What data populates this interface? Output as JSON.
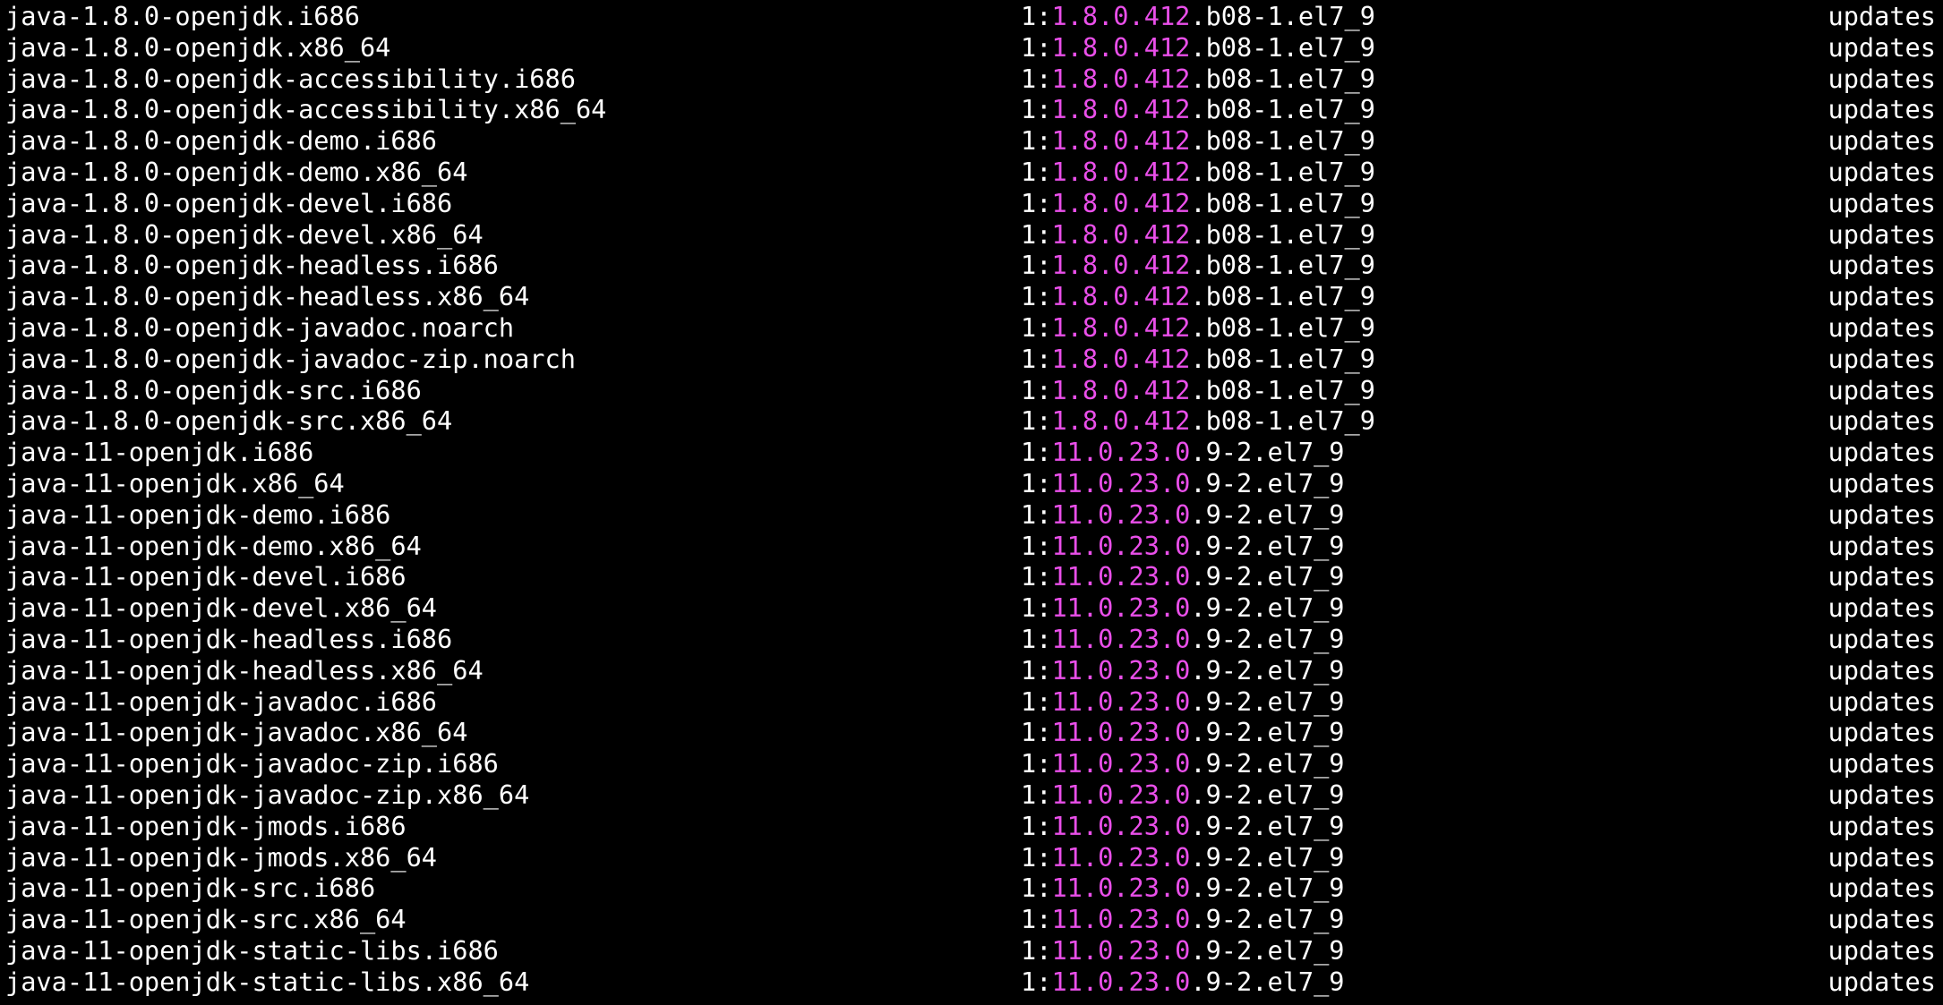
{
  "colors": {
    "background": "#000000",
    "text": "#ffffff",
    "highlight": "#ea4fea"
  },
  "rows": [
    {
      "name": "java-1.8.0-openjdk.i686",
      "epoch": "1:",
      "ver_hl": "1.8.0.412",
      "ver_rest": ".b08-1.el7_9",
      "repo": "updates"
    },
    {
      "name": "java-1.8.0-openjdk.x86_64",
      "epoch": "1:",
      "ver_hl": "1.8.0.412",
      "ver_rest": ".b08-1.el7_9",
      "repo": "updates"
    },
    {
      "name": "java-1.8.0-openjdk-accessibility.i686",
      "epoch": "1:",
      "ver_hl": "1.8.0.412",
      "ver_rest": ".b08-1.el7_9",
      "repo": "updates"
    },
    {
      "name": "java-1.8.0-openjdk-accessibility.x86_64",
      "epoch": "1:",
      "ver_hl": "1.8.0.412",
      "ver_rest": ".b08-1.el7_9",
      "repo": "updates"
    },
    {
      "name": "java-1.8.0-openjdk-demo.i686",
      "epoch": "1:",
      "ver_hl": "1.8.0.412",
      "ver_rest": ".b08-1.el7_9",
      "repo": "updates"
    },
    {
      "name": "java-1.8.0-openjdk-demo.x86_64",
      "epoch": "1:",
      "ver_hl": "1.8.0.412",
      "ver_rest": ".b08-1.el7_9",
      "repo": "updates"
    },
    {
      "name": "java-1.8.0-openjdk-devel.i686",
      "epoch": "1:",
      "ver_hl": "1.8.0.412",
      "ver_rest": ".b08-1.el7_9",
      "repo": "updates"
    },
    {
      "name": "java-1.8.0-openjdk-devel.x86_64",
      "epoch": "1:",
      "ver_hl": "1.8.0.412",
      "ver_rest": ".b08-1.el7_9",
      "repo": "updates"
    },
    {
      "name": "java-1.8.0-openjdk-headless.i686",
      "epoch": "1:",
      "ver_hl": "1.8.0.412",
      "ver_rest": ".b08-1.el7_9",
      "repo": "updates"
    },
    {
      "name": "java-1.8.0-openjdk-headless.x86_64",
      "epoch": "1:",
      "ver_hl": "1.8.0.412",
      "ver_rest": ".b08-1.el7_9",
      "repo": "updates"
    },
    {
      "name": "java-1.8.0-openjdk-javadoc.noarch",
      "epoch": "1:",
      "ver_hl": "1.8.0.412",
      "ver_rest": ".b08-1.el7_9",
      "repo": "updates"
    },
    {
      "name": "java-1.8.0-openjdk-javadoc-zip.noarch",
      "epoch": "1:",
      "ver_hl": "1.8.0.412",
      "ver_rest": ".b08-1.el7_9",
      "repo": "updates"
    },
    {
      "name": "java-1.8.0-openjdk-src.i686",
      "epoch": "1:",
      "ver_hl": "1.8.0.412",
      "ver_rest": ".b08-1.el7_9",
      "repo": "updates"
    },
    {
      "name": "java-1.8.0-openjdk-src.x86_64",
      "epoch": "1:",
      "ver_hl": "1.8.0.412",
      "ver_rest": ".b08-1.el7_9",
      "repo": "updates"
    },
    {
      "name": "java-11-openjdk.i686",
      "epoch": "1:",
      "ver_hl": "11.0.23.0",
      "ver_rest": ".9-2.el7_9",
      "repo": "updates"
    },
    {
      "name": "java-11-openjdk.x86_64",
      "epoch": "1:",
      "ver_hl": "11.0.23.0",
      "ver_rest": ".9-2.el7_9",
      "repo": "updates"
    },
    {
      "name": "java-11-openjdk-demo.i686",
      "epoch": "1:",
      "ver_hl": "11.0.23.0",
      "ver_rest": ".9-2.el7_9",
      "repo": "updates"
    },
    {
      "name": "java-11-openjdk-demo.x86_64",
      "epoch": "1:",
      "ver_hl": "11.0.23.0",
      "ver_rest": ".9-2.el7_9",
      "repo": "updates"
    },
    {
      "name": "java-11-openjdk-devel.i686",
      "epoch": "1:",
      "ver_hl": "11.0.23.0",
      "ver_rest": ".9-2.el7_9",
      "repo": "updates"
    },
    {
      "name": "java-11-openjdk-devel.x86_64",
      "epoch": "1:",
      "ver_hl": "11.0.23.0",
      "ver_rest": ".9-2.el7_9",
      "repo": "updates"
    },
    {
      "name": "java-11-openjdk-headless.i686",
      "epoch": "1:",
      "ver_hl": "11.0.23.0",
      "ver_rest": ".9-2.el7_9",
      "repo": "updates"
    },
    {
      "name": "java-11-openjdk-headless.x86_64",
      "epoch": "1:",
      "ver_hl": "11.0.23.0",
      "ver_rest": ".9-2.el7_9",
      "repo": "updates"
    },
    {
      "name": "java-11-openjdk-javadoc.i686",
      "epoch": "1:",
      "ver_hl": "11.0.23.0",
      "ver_rest": ".9-2.el7_9",
      "repo": "updates"
    },
    {
      "name": "java-11-openjdk-javadoc.x86_64",
      "epoch": "1:",
      "ver_hl": "11.0.23.0",
      "ver_rest": ".9-2.el7_9",
      "repo": "updates"
    },
    {
      "name": "java-11-openjdk-javadoc-zip.i686",
      "epoch": "1:",
      "ver_hl": "11.0.23.0",
      "ver_rest": ".9-2.el7_9",
      "repo": "updates"
    },
    {
      "name": "java-11-openjdk-javadoc-zip.x86_64",
      "epoch": "1:",
      "ver_hl": "11.0.23.0",
      "ver_rest": ".9-2.el7_9",
      "repo": "updates"
    },
    {
      "name": "java-11-openjdk-jmods.i686",
      "epoch": "1:",
      "ver_hl": "11.0.23.0",
      "ver_rest": ".9-2.el7_9",
      "repo": "updates"
    },
    {
      "name": "java-11-openjdk-jmods.x86_64",
      "epoch": "1:",
      "ver_hl": "11.0.23.0",
      "ver_rest": ".9-2.el7_9",
      "repo": "updates"
    },
    {
      "name": "java-11-openjdk-src.i686",
      "epoch": "1:",
      "ver_hl": "11.0.23.0",
      "ver_rest": ".9-2.el7_9",
      "repo": "updates"
    },
    {
      "name": "java-11-openjdk-src.x86_64",
      "epoch": "1:",
      "ver_hl": "11.0.23.0",
      "ver_rest": ".9-2.el7_9",
      "repo": "updates"
    },
    {
      "name": "java-11-openjdk-static-libs.i686",
      "epoch": "1:",
      "ver_hl": "11.0.23.0",
      "ver_rest": ".9-2.el7_9",
      "repo": "updates"
    },
    {
      "name": "java-11-openjdk-static-libs.x86_64",
      "epoch": "1:",
      "ver_hl": "11.0.23.0",
      "ver_rest": ".9-2.el7_9",
      "repo": "updates"
    }
  ]
}
